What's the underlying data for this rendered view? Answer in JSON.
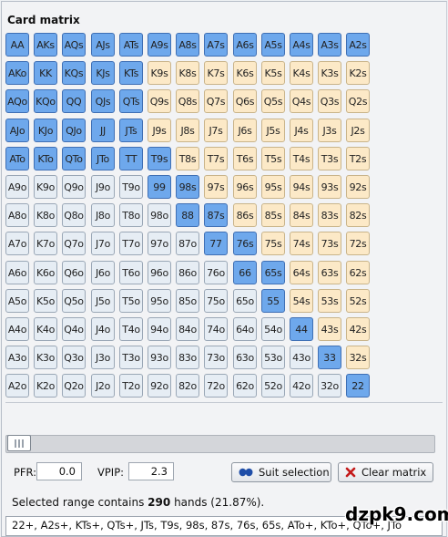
{
  "panel": {
    "title": "Card matrix"
  },
  "ranks": [
    "A",
    "K",
    "Q",
    "J",
    "T",
    "9",
    "8",
    "7",
    "6",
    "5",
    "4",
    "3",
    "2"
  ],
  "selected": [
    "AA",
    "AKs",
    "AQs",
    "AJs",
    "ATs",
    "A9s",
    "A8s",
    "A7s",
    "A6s",
    "A5s",
    "A4s",
    "A3s",
    "A2s",
    "AKo",
    "KK",
    "KQs",
    "KJs",
    "KTs",
    "AQo",
    "KQo",
    "QQ",
    "QJs",
    "QTs",
    "AJo",
    "KJo",
    "QJo",
    "JJ",
    "JTs",
    "ATo",
    "KTo",
    "QTo",
    "JTo",
    "TT",
    "T9s",
    "99",
    "98s",
    "88",
    "87s",
    "77",
    "76s",
    "66",
    "65s",
    "55",
    "44",
    "33",
    "22"
  ],
  "stats": {
    "pfr_label": "PFR:",
    "pfr_value": "0.0",
    "vpip_label": "VPIP:",
    "vpip_value": "2.3"
  },
  "buttons": {
    "suit_selection": "Suit selection",
    "clear_matrix": "Clear matrix"
  },
  "summary": {
    "prefix": "Selected range contains",
    "hands": "290",
    "suffix": "hands (21.87%)."
  },
  "range_text": "22+, A2s+, KTs+, QTs+, JTs, T9s, 98s, 87s, 76s, 65s, ATo+, KTo+, QTo+, JTo",
  "watermark": "dzpk9.com",
  "colors": {
    "selected": "#6ea8ec",
    "suited": "#fce9c7",
    "offsuit": "#e6edf4"
  }
}
